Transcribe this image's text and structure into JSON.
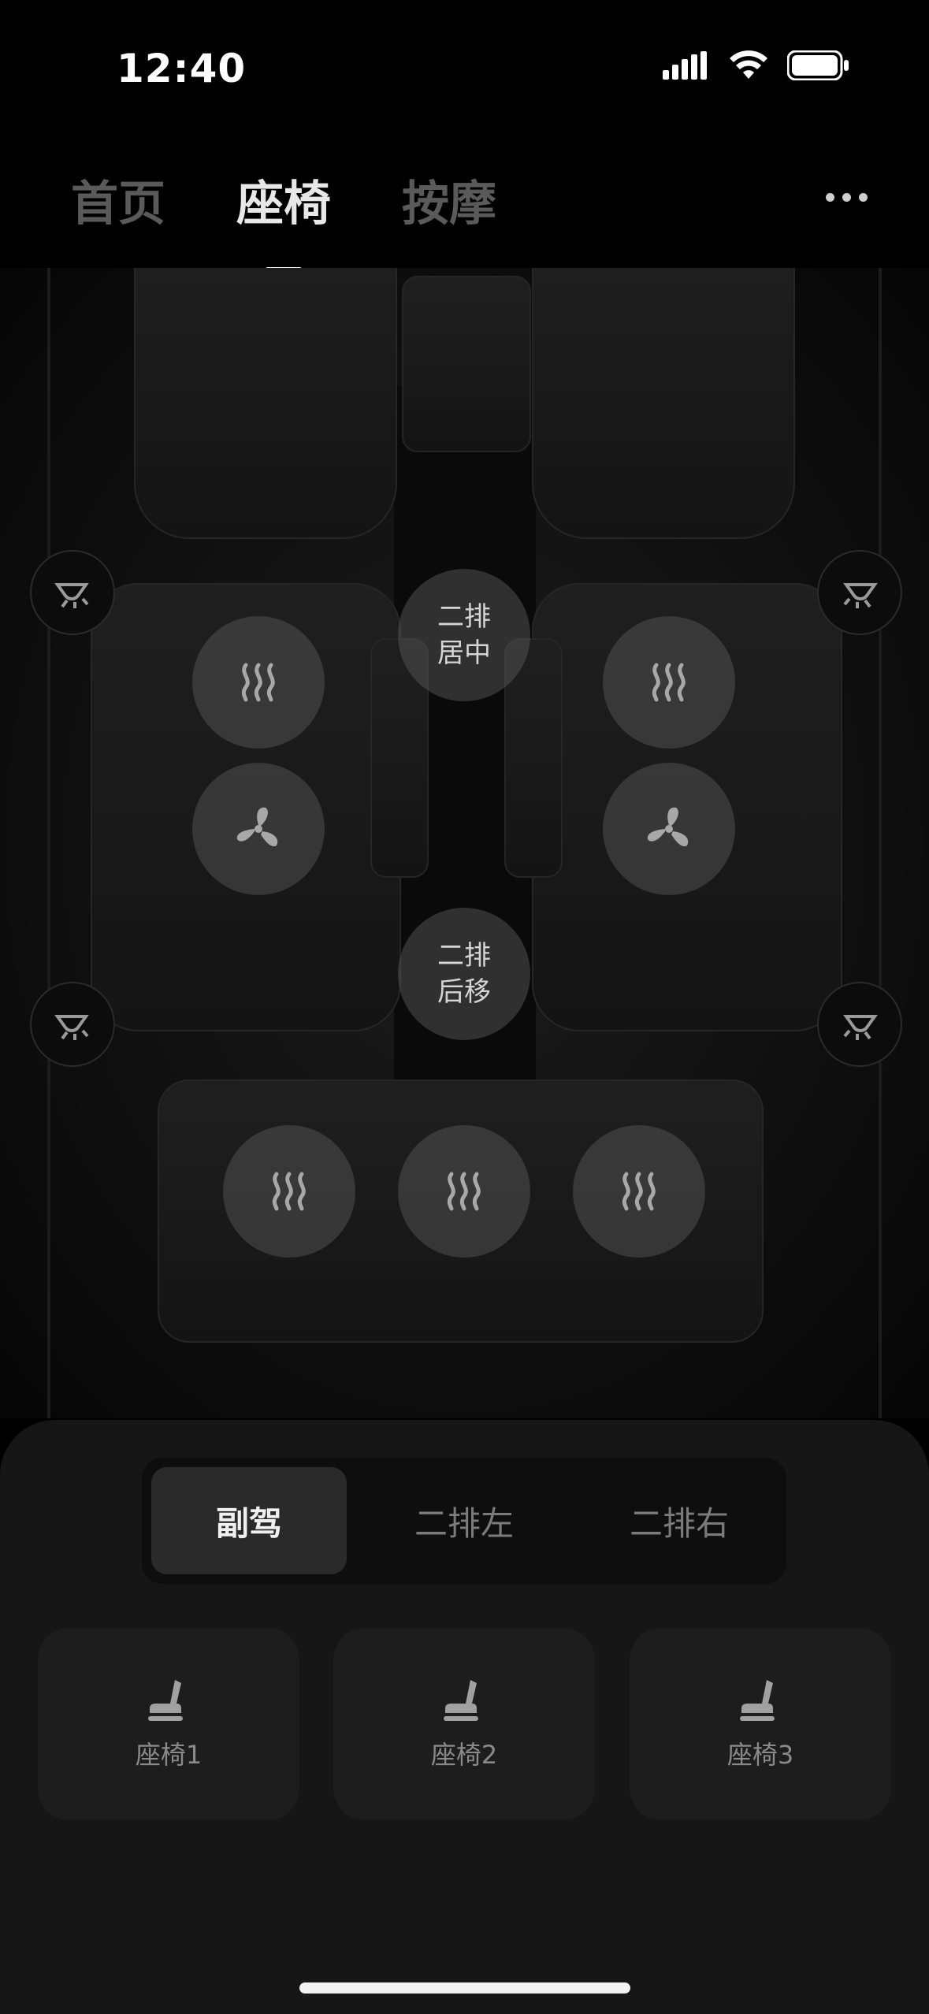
{
  "status_bar": {
    "time": "12:40"
  },
  "tabs": [
    {
      "label": "首页",
      "active": false
    },
    {
      "label": "座椅",
      "active": true
    },
    {
      "label": "按摩",
      "active": false
    }
  ],
  "scene": {
    "center_buttons": {
      "row2_center": {
        "line1": "二排",
        "line2": "居中"
      },
      "row2_back": {
        "line1": "二排",
        "line2": "后移"
      }
    }
  },
  "segment": {
    "items": [
      {
        "label": "副驾",
        "active": true
      },
      {
        "label": "二排左",
        "active": false
      },
      {
        "label": "二排右",
        "active": false
      }
    ]
  },
  "presets": [
    {
      "label": "座椅1",
      "icon": "seat-icon"
    },
    {
      "label": "座椅2",
      "icon": "seat-icon"
    },
    {
      "label": "座椅3",
      "icon": "seat-icon"
    }
  ],
  "colors": {
    "background": "#000000",
    "panel": "#161616",
    "accent_text": "#e8e8e8",
    "muted_text": "#5a5a5a"
  }
}
